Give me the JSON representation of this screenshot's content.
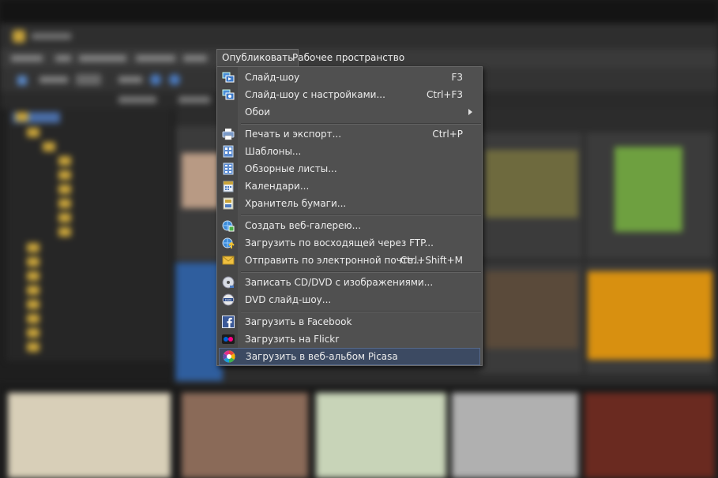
{
  "menubar": {
    "items": [
      {
        "label": "Опубликовать"
      },
      {
        "label": "Рабочее пространство"
      }
    ]
  },
  "menu": {
    "items": [
      {
        "label": "Слайд-шоу",
        "shortcut": "F3",
        "icon": "slideshow-icon"
      },
      {
        "label": "Слайд-шоу с настройками...",
        "shortcut": "Ctrl+F3",
        "icon": "slideshow-settings-icon"
      },
      {
        "label": "Обои",
        "shortcut": "",
        "icon": ""
      },
      {
        "label": "Печать и экспорт...",
        "shortcut": "Ctrl+P",
        "icon": "printer-icon"
      },
      {
        "label": "Шаблоны...",
        "shortcut": "",
        "icon": "templates-icon"
      },
      {
        "label": "Обзорные листы...",
        "shortcut": "",
        "icon": "contact-sheets-icon"
      },
      {
        "label": "Календари...",
        "shortcut": "",
        "icon": "calendar-icon"
      },
      {
        "label": "Хранитель бумаги...",
        "shortcut": "",
        "icon": "paper-saver-icon"
      },
      {
        "label": "Создать веб-галерею...",
        "shortcut": "",
        "icon": "web-gallery-icon"
      },
      {
        "label": "Загрузить по восходящей через FTP...",
        "shortcut": "",
        "icon": "ftp-upload-icon"
      },
      {
        "label": "Отправить по электронной почте...",
        "shortcut": "Ctrl+Shift+M",
        "icon": "email-envelope-icon"
      },
      {
        "label": "Записать CD/DVD с изображениями...",
        "shortcut": "",
        "icon": "disc-burn-icon"
      },
      {
        "label": "DVD слайд-шоу...",
        "shortcut": "",
        "icon": "dvd-icon"
      },
      {
        "label": "Загрузить в Facebook",
        "shortcut": "",
        "icon": "facebook-icon"
      },
      {
        "label": "Загрузить на Flickr",
        "shortcut": "",
        "icon": "flickr-icon"
      },
      {
        "label": "Загрузить в веб-альбом Picasa",
        "shortcut": "",
        "icon": "picasa-icon"
      }
    ]
  },
  "colors": {
    "menu_bg": "#505050",
    "highlight_bg": "#3c4a62",
    "facebook": "#3b5998",
    "flickr_blue": "#0063dc",
    "flickr_pink": "#ff0084",
    "folder_yellow": "#c9a43a"
  }
}
